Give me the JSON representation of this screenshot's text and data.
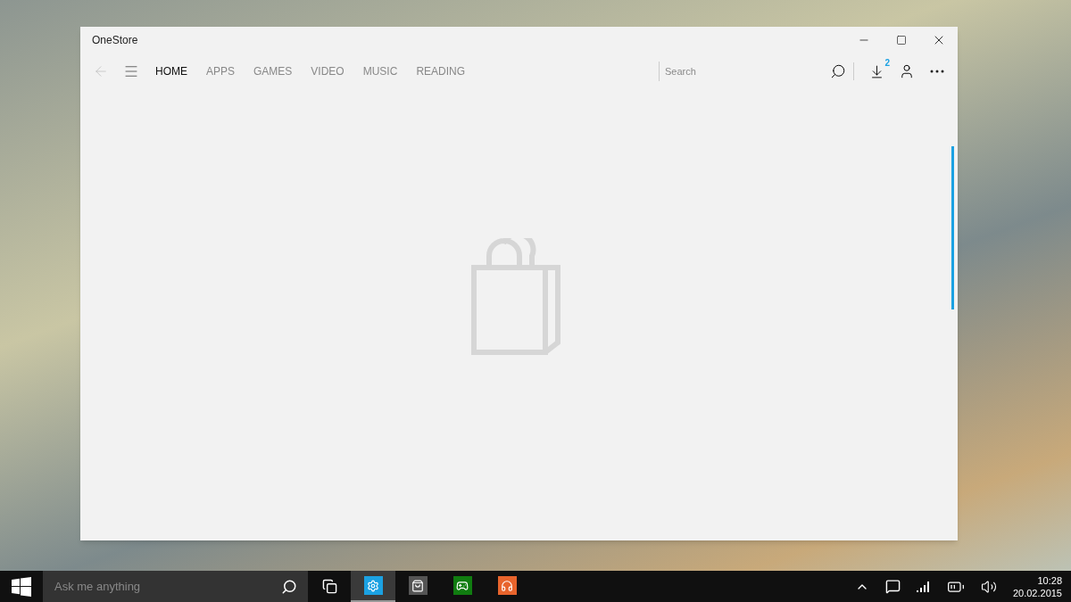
{
  "window": {
    "title": "OneStore"
  },
  "nav_tabs": [
    {
      "label": "HOME",
      "selected": true
    },
    {
      "label": "APPS",
      "selected": false
    },
    {
      "label": "GAMES",
      "selected": false
    },
    {
      "label": "VIDEO",
      "selected": false
    },
    {
      "label": "MUSIC",
      "selected": false
    },
    {
      "label": "READING",
      "selected": false
    }
  ],
  "search": {
    "placeholder": "Search"
  },
  "downloads_badge": "2",
  "taskbar": {
    "search_placeholder": "Ask me anything",
    "apps": [
      {
        "kind": "settings",
        "color": "#1ba1e2",
        "selected": true
      },
      {
        "kind": "store",
        "color": "#555555",
        "selected": false
      },
      {
        "kind": "xbox",
        "color": "#107c10",
        "selected": false
      },
      {
        "kind": "music",
        "color": "#e8642c",
        "selected": false
      }
    ],
    "time": "10:28",
    "date": "20.02.2015"
  }
}
